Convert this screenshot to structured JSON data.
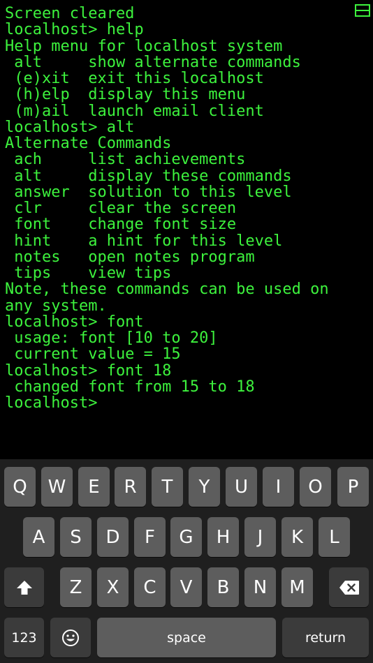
{
  "terminal": {
    "lines": [
      "Screen cleared",
      "localhost> help",
      "Help menu for localhost system",
      " alt     show alternate commands",
      " (e)xit  exit this localhost",
      " (h)elp  display this menu",
      " (m)ail  launch email client",
      "localhost> alt",
      "Alternate Commands",
      " ach     list achievements",
      " alt     display these commands",
      " answer  solution to this level",
      " clr     clear the screen",
      " font    change font size",
      " hint    a hint for this level",
      " notes   open notes program",
      " tips    view tips",
      "Note, these commands can be used on",
      "any system.",
      "localhost> font",
      " usage: font [10 to 20]",
      " current value = 15",
      "localhost> font 18",
      " changed font from 15 to 18",
      "localhost>"
    ],
    "text_color": "#3df23d",
    "menu_icon": "menu-icon"
  },
  "keyboard": {
    "row1": [
      "Q",
      "W",
      "E",
      "R",
      "T",
      "Y",
      "U",
      "I",
      "O",
      "P"
    ],
    "row2": [
      "A",
      "S",
      "D",
      "F",
      "G",
      "H",
      "J",
      "K",
      "L"
    ],
    "row3": [
      "Z",
      "X",
      "C",
      "V",
      "B",
      "N",
      "M"
    ],
    "shift_icon": "shift-arrow-icon",
    "backspace_icon": "backspace-icon",
    "emoji_icon": "emoji-icon",
    "numbers_label": "123",
    "space_label": "space",
    "return_label": "return"
  }
}
